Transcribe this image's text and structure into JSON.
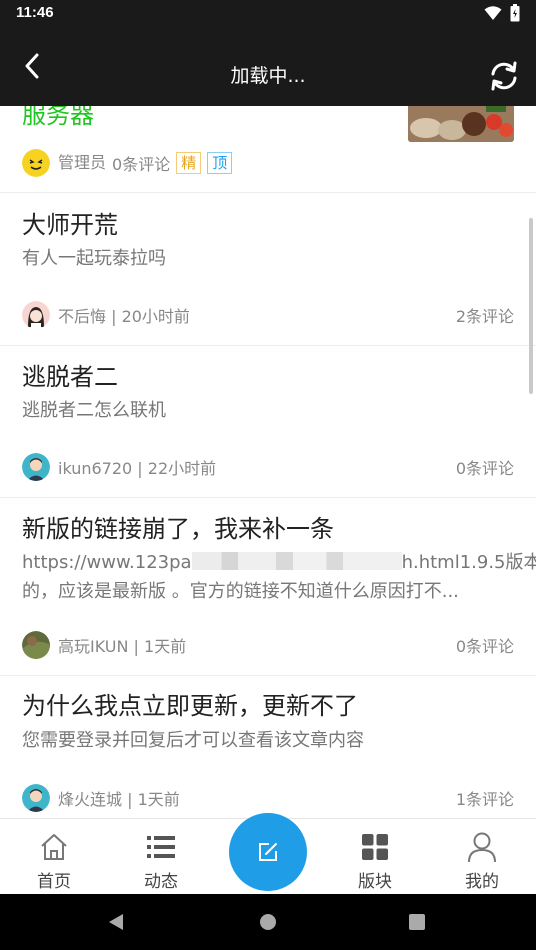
{
  "status_bar": {
    "time": "11:46"
  },
  "app_bar": {
    "title": "加载中..."
  },
  "partial_post": {
    "title": "服务器",
    "author": "管理员",
    "comments": "0条评论",
    "tags": [
      "精",
      "顶"
    ]
  },
  "posts": [
    {
      "title": "大师开荒",
      "excerpt": "有人一起玩泰拉吗",
      "author_time": "不后悔 | 20小时前",
      "comments": "2条评论"
    },
    {
      "title": "逃脱者二",
      "excerpt": "逃脱者二怎么联机",
      "author_time": "ikun6720 | 22小时前",
      "comments": "0条评论"
    },
    {
      "title": "新版的链接崩了，我来补一条",
      "excerpt_start": "https://www.123pa",
      "excerpt_end": "h.html1.9.5版本",
      "excerpt_line2": "的，应该是最新版 。官方的链接不知道什么原因打不...",
      "author_time": "高玩IKUN | 1天前",
      "comments": "0条评论"
    },
    {
      "title": "为什么我点立即更新，更新不了",
      "excerpt": "您需要登录并回复后才可以查看该文章内容",
      "author_time": "烽火连城 | 1天前",
      "comments": "1条评论"
    }
  ],
  "bottom_nav": [
    {
      "label": "首页",
      "icon": "home-icon"
    },
    {
      "label": "动态",
      "icon": "list-icon"
    },
    {
      "label": "",
      "icon": "compose-icon"
    },
    {
      "label": "版块",
      "icon": "grid-icon"
    },
    {
      "label": "我的",
      "icon": "user-icon"
    }
  ],
  "colors": {
    "accent": "#1f9de6",
    "partial_title": "#21c521",
    "app_bar": "#1a1a1a"
  }
}
